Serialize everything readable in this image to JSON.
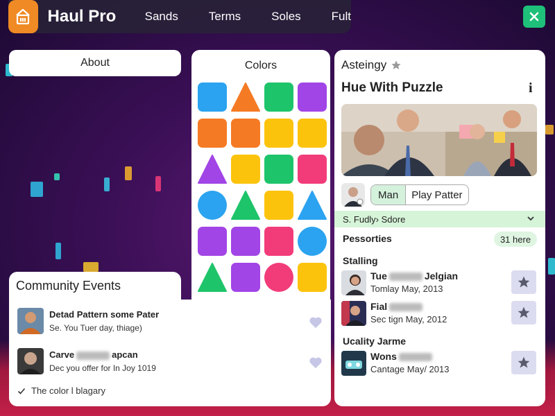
{
  "app": {
    "brand": "Haul Pro",
    "accent": "#f08a24",
    "nav": [
      "Sands",
      "Terms",
      "Soles",
      "Fult"
    ]
  },
  "about": {
    "label": "About"
  },
  "colors_panel": {
    "title": "Colors",
    "tiles": [
      {
        "shape": "square",
        "color": "#2ba3f0"
      },
      {
        "shape": "triangle",
        "color": "#f57a24"
      },
      {
        "shape": "square",
        "color": "#1ec46a"
      },
      {
        "shape": "square",
        "color": "#a145e6"
      },
      {
        "shape": "square",
        "color": "#f57a24"
      },
      {
        "shape": "square",
        "color": "#f57a24"
      },
      {
        "shape": "square",
        "color": "#fcc30d"
      },
      {
        "shape": "square",
        "color": "#fcc30d"
      },
      {
        "shape": "triangle",
        "color": "#a145e6"
      },
      {
        "shape": "square",
        "color": "#fcc30d"
      },
      {
        "shape": "square",
        "color": "#1ec46a"
      },
      {
        "shape": "square",
        "color": "#f23c7a"
      },
      {
        "shape": "circle",
        "color": "#2ba3f0"
      },
      {
        "shape": "triangle",
        "color": "#1ec46a"
      },
      {
        "shape": "square",
        "color": "#fcc30d"
      },
      {
        "shape": "triangle",
        "color": "#2ba3f0"
      },
      {
        "shape": "square",
        "color": "#a145e6"
      },
      {
        "shape": "square",
        "color": "#a145e6"
      },
      {
        "shape": "square",
        "color": "#f23c7a"
      },
      {
        "shape": "circle",
        "color": "#2ba3f0"
      },
      {
        "shape": "triangle",
        "color": "#1ec46a"
      },
      {
        "shape": "square",
        "color": "#a145e6"
      },
      {
        "shape": "circle",
        "color": "#f23c7a"
      },
      {
        "shape": "square",
        "color": "#fcc30d"
      }
    ]
  },
  "right": {
    "header": "Asteingy",
    "title": "Hue With Puzzle",
    "chip_a": "Man",
    "chip_b": "Play Patter",
    "select_label": "S. Fudly› Sdore",
    "section1": "Pessorties",
    "badge": "31 here",
    "section2": "Stalling",
    "rows": [
      {
        "title_a": "Tue",
        "title_b": "Jelgian",
        "sub": "Tomlay May, 2013"
      },
      {
        "title_a": "Fial",
        "title_b": "",
        "sub": "Sec tign May, 2012"
      }
    ],
    "section3": "Ucality Jarme",
    "row3": {
      "title_a": "Wons",
      "title_b": "",
      "sub": "Cantage May/ 2013"
    }
  },
  "events": {
    "title": "Community Events",
    "items": [
      {
        "title": "Detad Pattern some Pater",
        "sub": "Se. You Tuer day, thiage)"
      },
      {
        "title": "Carve",
        "title_b": "apcan",
        "sub": "Dec you offer for In Joy 1019"
      }
    ],
    "footer": "The color l blagary"
  }
}
